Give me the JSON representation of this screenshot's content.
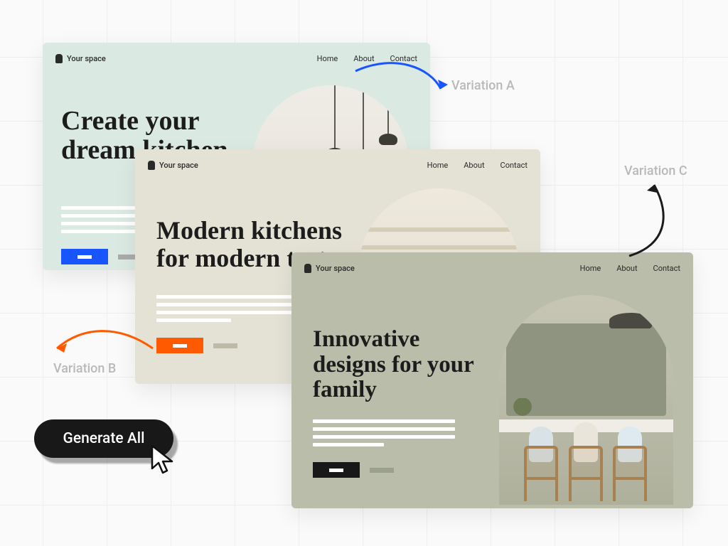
{
  "brand": "Your space",
  "nav": {
    "home": "Home",
    "about": "About",
    "contact": "Contact"
  },
  "cards": {
    "a": {
      "headline": "Create your dream kitchen",
      "accent": "#1955ff",
      "variation_label": "Variation A"
    },
    "b": {
      "headline": "Modern kitchens for modern tastes",
      "accent": "#ff5a00",
      "variation_label": "Variation B"
    },
    "c": {
      "headline": "Innovative designs for your family",
      "accent": "#181818",
      "variation_label": "Variation C"
    }
  },
  "generate_button": "Generate All"
}
